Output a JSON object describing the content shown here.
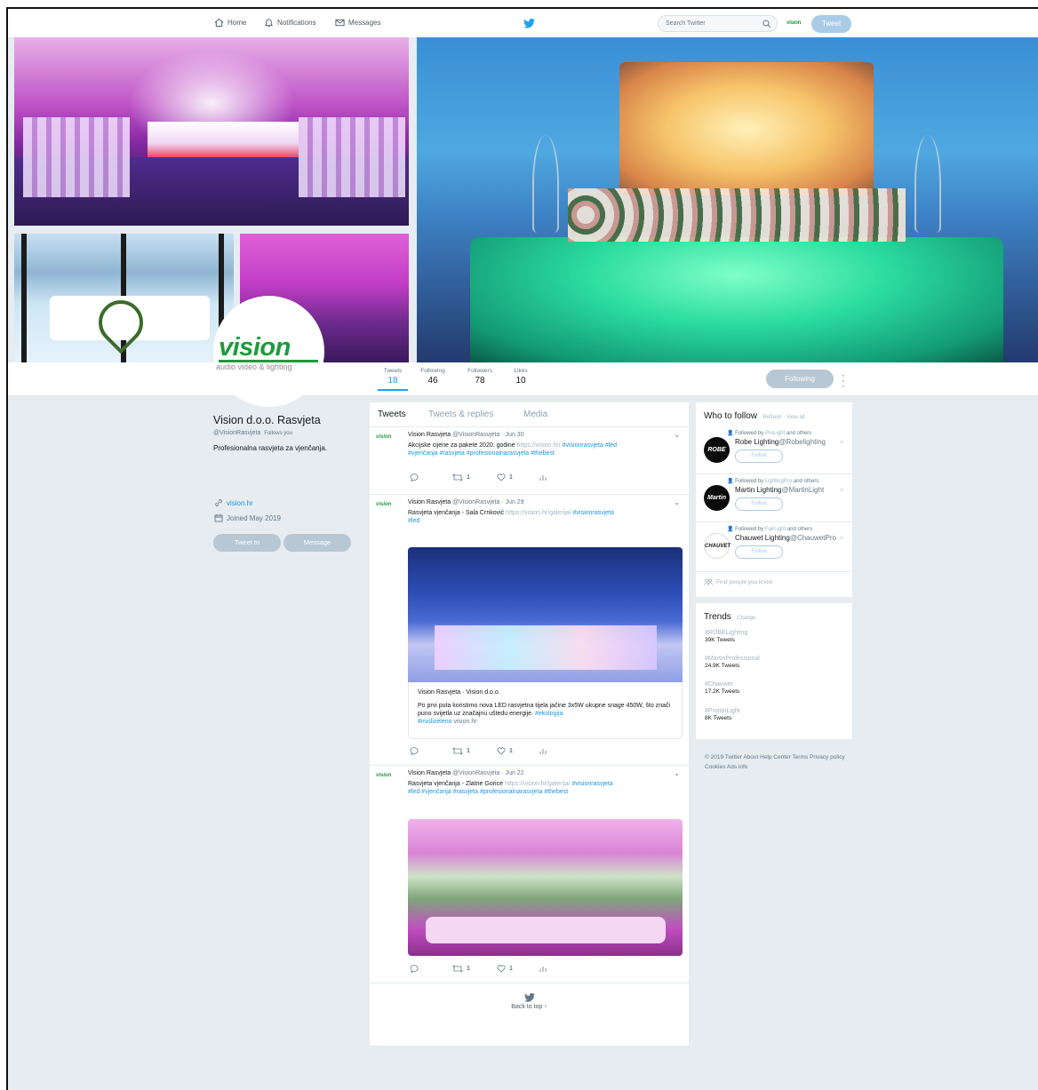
{
  "nav": {
    "home": "Home",
    "notifications": "Notifications",
    "messages": "Messages",
    "search_placeholder": "Search Twitter",
    "avatar_text": "vision",
    "tweet_button": "Tweet"
  },
  "profile": {
    "name": "Vision d.o.o. Rasvjeta",
    "handle": "@VisionRasvjeta",
    "follows_you": "Follows you",
    "bio": "Profesionalna rasvjeta za vjenčanja.",
    "website": "vision.hr",
    "joined": "Joined May 2019",
    "tweet_to": "Tweet to",
    "message": "Message",
    "logo_main": "vision",
    "logo_sub": "audio video & lighting"
  },
  "stats": [
    {
      "label": "Tweets",
      "value": "18"
    },
    {
      "label": "Following",
      "value": "46"
    },
    {
      "label": "Followers",
      "value": "78"
    },
    {
      "label": "Likes",
      "value": "10"
    }
  ],
  "following_button": "Following",
  "tabs": [
    "Tweets",
    "Tweets & replies",
    "Media"
  ],
  "tweets": [
    {
      "name": "Vision Rasvjeta",
      "meta": "@VisionRasvjeta · Jun 30",
      "text": "Akcijske cijene za pakete 2020. godine",
      "url": "https://vision.hr/",
      "tags1": "#visionrasvjeta #led",
      "tags2": "#vjenčanja #rasvjeta #profesionalnarasvjeta #thebest",
      "retweets": "1",
      "likes": "1"
    },
    {
      "name": "Vision Rasvjeta",
      "meta": "@VisionRasvjeta · Jun 29",
      "text": "Rasvjeta vjenčanja - Sala Crnković",
      "url": "https://vision.hr/galerija/",
      "tags1": "#visionrasvjeta",
      "tags2": "#led",
      "card_title": "Vision Rasvjeta · Vision d.o.o.",
      "card_text": "Po prvi puta koristimo nova LED rasvjetna tijela jačine 3x5W ukupne snage 450W, što znači puno svijetla uz značajnu uštedu energije.",
      "card_tag": "#ekologija",
      "card_tag2": "#mislizeleno",
      "card_link": "vision.hr",
      "retweets": "1",
      "likes": "1"
    },
    {
      "name": "Vision Rasvjeta",
      "meta": "@VisionRasvjeta · Jun 22",
      "text": "Rasvjeta vjenčanja - Zlatne Gorice",
      "url": "https://vision.hr/galerija/",
      "tags1": "#visionrasvjeta",
      "tags2": "#led #vjenčanja #rasvjeta #profesionalnarasvjeta #thebest",
      "retweets": "1",
      "likes": "1"
    }
  ],
  "back_to_top": "Back to top ↑",
  "who_to_follow": {
    "title": "Who to follow",
    "links": "· Refresh · View all",
    "suggestions": [
      {
        "followed_by": "Followed by",
        "fb_user": "ProLight",
        "and_others": "and others",
        "name": "Robe Lighting",
        "handle": "@Robelighting",
        "avatar": "ROBE",
        "follow": "Follow"
      },
      {
        "followed_by": "Followed by",
        "fb_user": "LightingPro",
        "and_others": "and others",
        "name": "Martin Lighting",
        "handle": "@MartinLight",
        "avatar": "Martin",
        "follow": "Follow"
      },
      {
        "followed_by": "Followed by",
        "fb_user": "FairLight",
        "and_others": "and others",
        "name": "Chauwet Lighting",
        "handle": "@ChauwetPro",
        "avatar": "CHAUVET",
        "follow": "Follow"
      }
    ],
    "find_people": "Find people you know"
  },
  "trends": {
    "title": "Trends",
    "change": "· Change",
    "items": [
      {
        "name": "#ROBELighting",
        "count": "39K Tweets"
      },
      {
        "name": "#MartinProfessional",
        "count": "24.9K Tweets"
      },
      {
        "name": "#Chauwet",
        "count": "17.2K Tweets"
      },
      {
        "name": "#ProtonLight",
        "count": "8K Tweets"
      }
    ]
  },
  "footer": "© 2019 Twitter About Help Center Terms Privacy policy Cookies Ads info",
  "colors": {
    "accent": "#1da1f2",
    "brand_green": "#1e9b3a",
    "background": "#e6ecf0"
  }
}
